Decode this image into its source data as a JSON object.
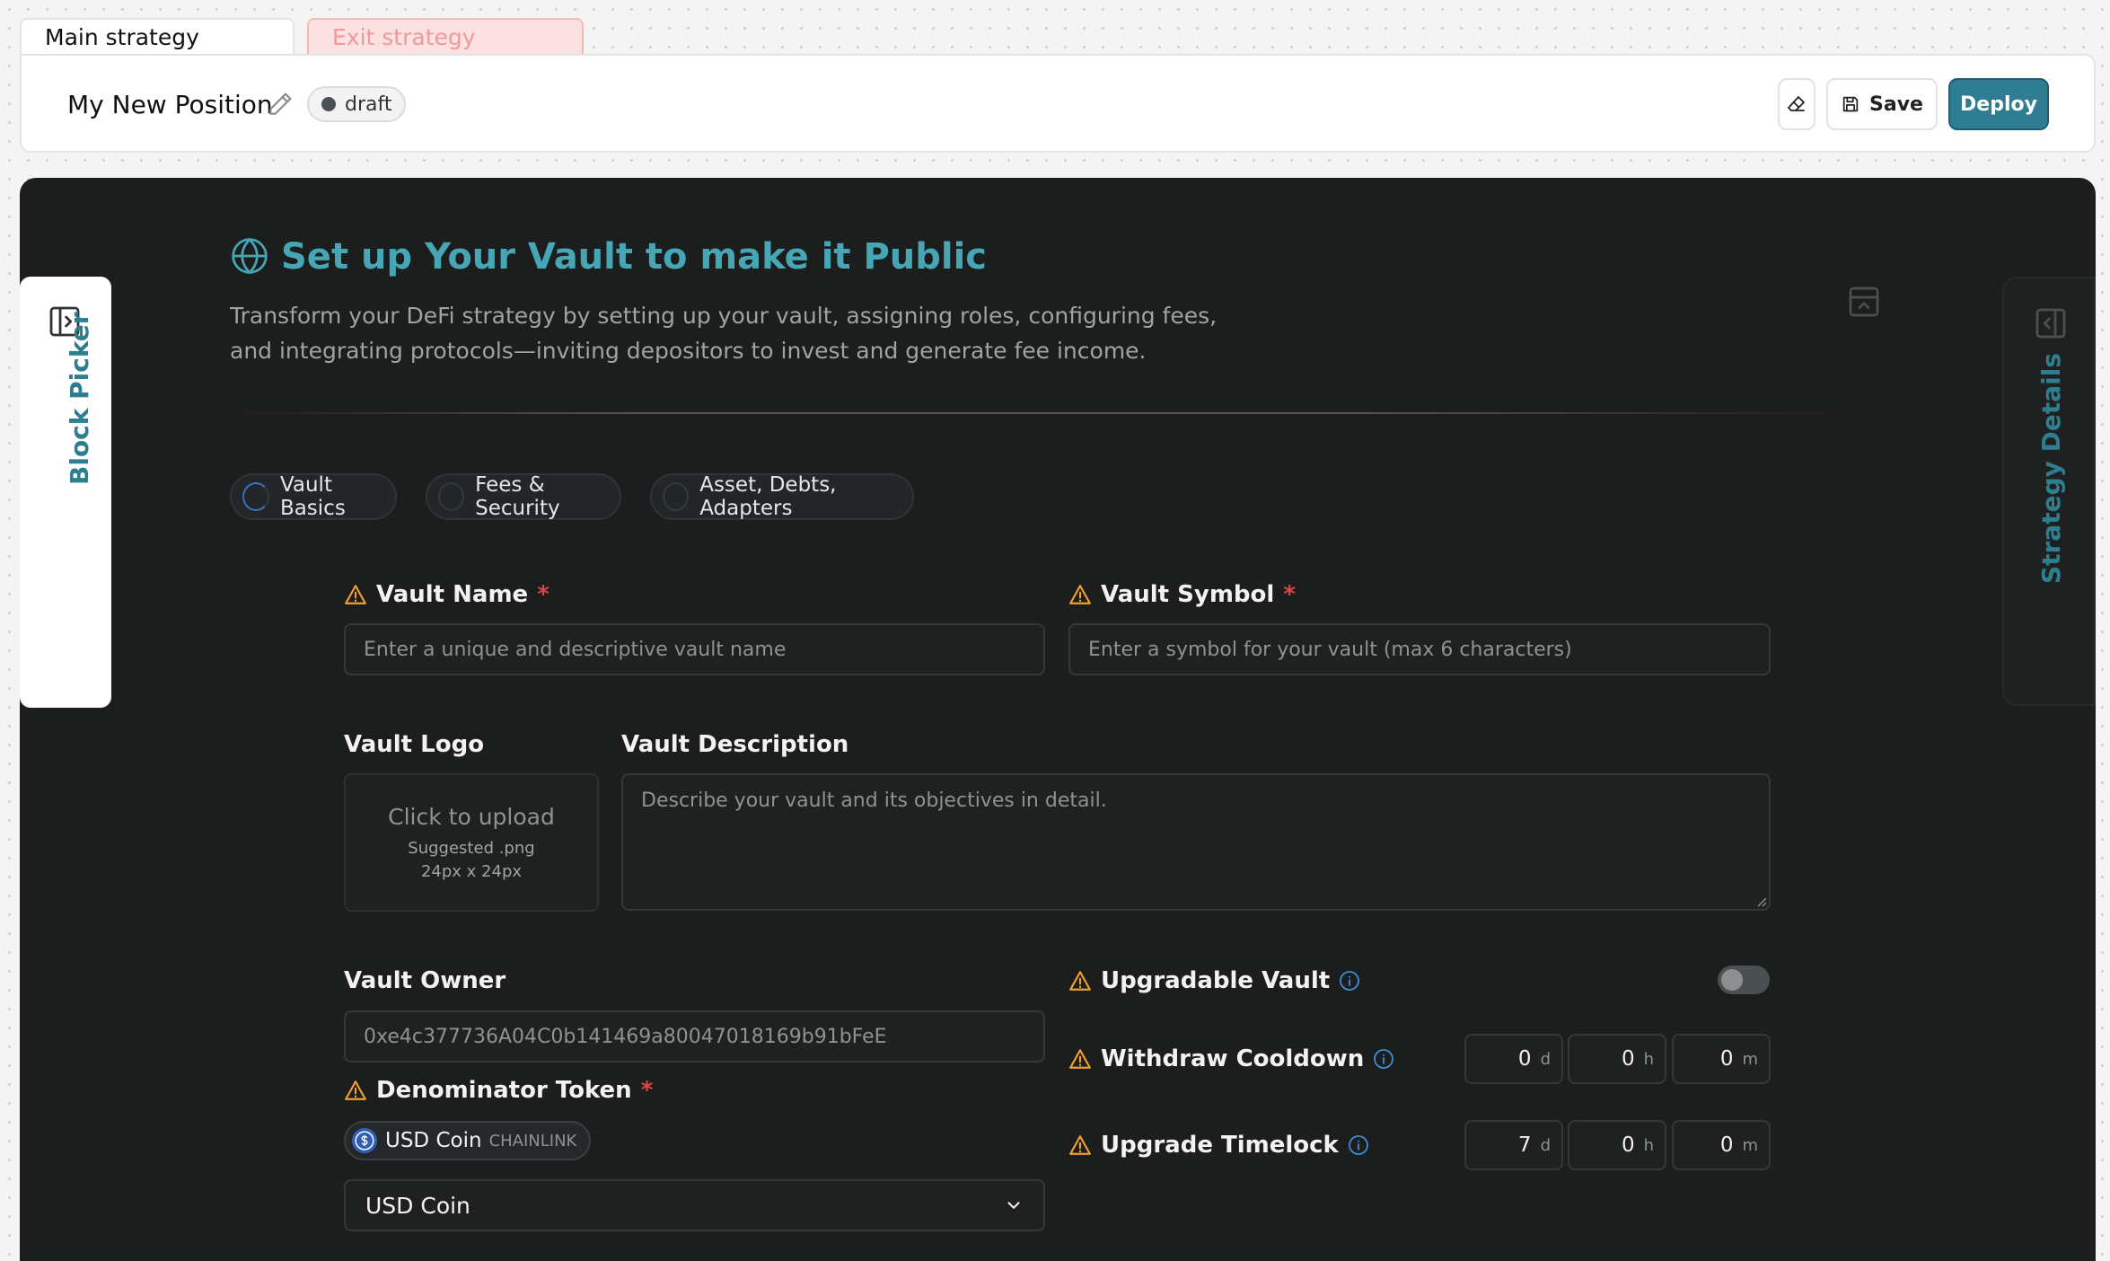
{
  "tabs": {
    "main": "Main strategy",
    "exit": "Exit strategy"
  },
  "header": {
    "title": "My New Position",
    "status": "draft",
    "save_label": "Save",
    "deploy_label": "Deploy"
  },
  "side_panels": {
    "left": "Block Picker",
    "right": "Strategy Details"
  },
  "intro": {
    "title": "Set up Your Vault to make it Public",
    "description": "Transform your DeFi strategy by setting up your vault, assigning roles, configuring fees, and integrating protocols—inviting depositors to invest and generate fee income."
  },
  "steps": [
    {
      "label": "Vault Basics"
    },
    {
      "label": "Fees & Security"
    },
    {
      "label": "Asset, Debts, Adapters"
    }
  ],
  "form": {
    "vault_name": {
      "label": "Vault Name",
      "required": "*",
      "placeholder": "Enter a unique and descriptive vault name"
    },
    "vault_symbol": {
      "label": "Vault Symbol",
      "required": "*",
      "placeholder": "Enter a symbol for your vault (max 6 characters)"
    },
    "vault_logo": {
      "label": "Vault Logo",
      "upload_text": "Click to upload",
      "hint_line1": "Suggested .png",
      "hint_line2": "24px x 24px"
    },
    "vault_description": {
      "label": "Vault Description",
      "placeholder": "Describe your vault and its objectives in detail."
    },
    "vault_owner": {
      "label": "Vault Owner",
      "value": "0xe4c377736A04C0b141469a80047018169b91bFeE"
    },
    "denominator_token": {
      "label": "Denominator Token",
      "required": "*",
      "chip_name": "USD Coin",
      "chip_source": "CHAINLINK",
      "selected": "USD Coin"
    },
    "upgradable_vault": {
      "label": "Upgradable Vault",
      "enabled": false
    },
    "withdraw_cooldown": {
      "label": "Withdraw Cooldown",
      "days": "0",
      "hours": "0",
      "minutes": "0"
    },
    "upgrade_timelock": {
      "label": "Upgrade Timelock",
      "days": "7",
      "hours": "0",
      "minutes": "0"
    },
    "units": {
      "d": "d",
      "h": "h",
      "m": "m"
    }
  },
  "colors": {
    "accent": "#46a6b5",
    "deploy": "#2f7d92",
    "warning": "#f0a030",
    "info": "#3b8fd8",
    "required": "#d94848",
    "panel_bg": "#1c1d1d"
  }
}
